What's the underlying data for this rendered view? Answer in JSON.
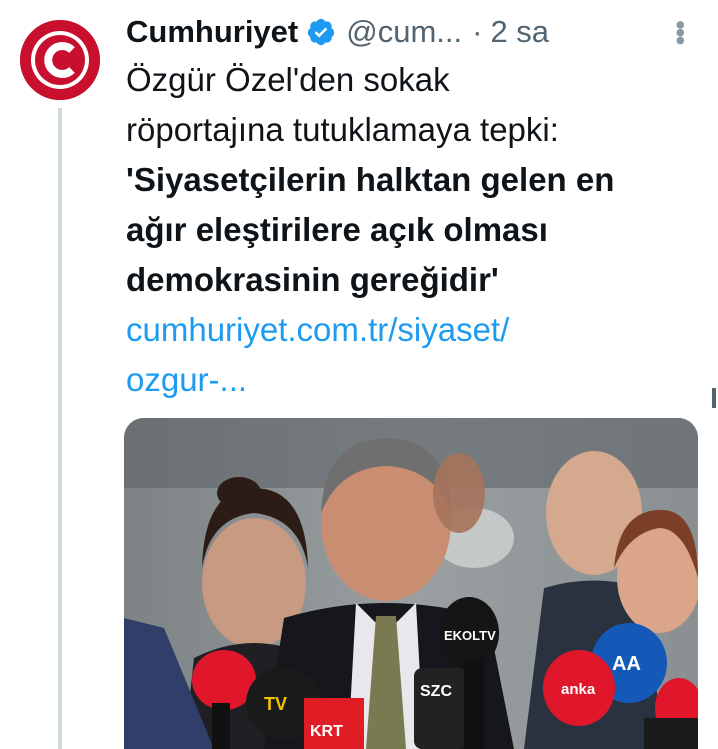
{
  "account": {
    "name": "Cumhuriyet",
    "handle": "@cum...",
    "separator": "·",
    "time": "2 sa",
    "verified": true
  },
  "tweet": {
    "lines": [
      "Özgür Özel'den sokak",
      "röportajına tutuklamaya tepki:"
    ],
    "quote_lines": [
      "'Siyasetçilerin halktan gelen en",
      "ağır eleştirilere açık olması",
      "demokrasinin gereğidir'"
    ],
    "link_lines": [
      "cumhuriyet.com.tr/siyaset/",
      "ozgur-..."
    ]
  },
  "media": {
    "mic_labels": [
      "TV",
      "KRT",
      "SZC",
      "EKOLTV",
      "AA",
      "anka"
    ]
  },
  "colors": {
    "brand_red": "#c8102e",
    "link_blue": "#1d9bf0",
    "verified_blue": "#1d9bf0",
    "muted_text": "#536471"
  },
  "icons": {
    "avatar": "cumhuriyet-c-logo-icon",
    "verified": "verified-badge-icon",
    "more": "more-dots-icon"
  }
}
